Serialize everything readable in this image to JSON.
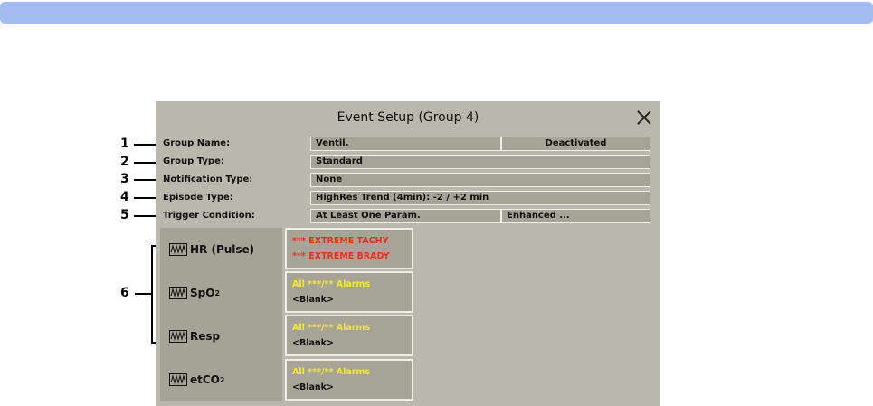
{
  "dialog": {
    "title": "Event Setup (Group 4)"
  },
  "rows": [
    {
      "callout": "1",
      "label": "Group Name:",
      "value": "Ventil.",
      "value2": "Deactivated"
    },
    {
      "callout": "2",
      "label": "Group Type:",
      "value": "Standard"
    },
    {
      "callout": "3",
      "label": "Notification Type:",
      "value": "None"
    },
    {
      "callout": "4",
      "label": "Episode Type:",
      "value": "HighRes Trend (4min): -2 / +2 min"
    },
    {
      "callout": "5",
      "label": "Trigger Condition:",
      "value": "At Least One Param.",
      "value2": "Enhanced ..."
    }
  ],
  "params": [
    {
      "label": "HR (Pulse)",
      "sub": ""
    },
    {
      "label": "SpO",
      "sub": "2"
    },
    {
      "label": "Resp",
      "sub": ""
    },
    {
      "label": "etCO",
      "sub": "2"
    }
  ],
  "alarms": [
    {
      "line1": "*** EXTREME TACHY",
      "line2": "*** EXTREME BRADY"
    },
    {
      "line1": "All ***/** Alarms",
      "line2": "<Blank>"
    },
    {
      "line1": "All ***/** Alarms",
      "line2": "<Blank>"
    },
    {
      "line1": "All ***/** Alarms",
      "line2": "<Blank>"
    }
  ],
  "callout_params": "6",
  "colors": {
    "header_bar": "#a3bcef",
    "dialog_bg": "#bab8ac",
    "field_bg": "#a6a496",
    "alarm_red": "#ff2a1a",
    "alarm_yellow": "#f6ea22"
  }
}
